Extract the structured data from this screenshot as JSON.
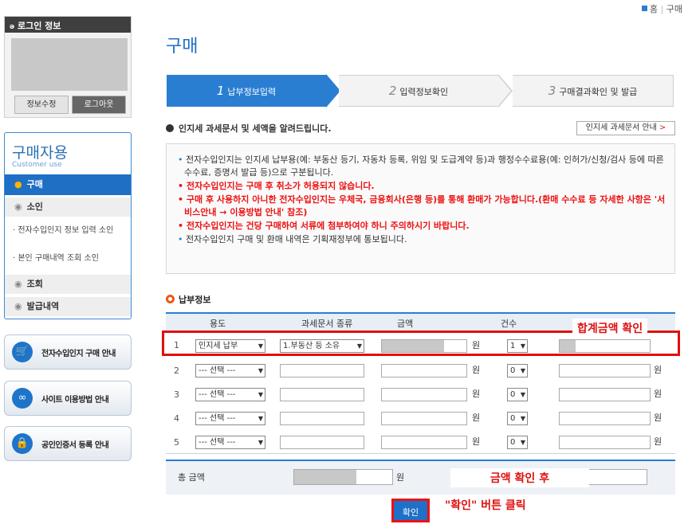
{
  "topnav": {
    "home": "홈",
    "sep": "|",
    "buy": "구매"
  },
  "login": {
    "title": "로그인 정보",
    "edit_btn": "정보수정",
    "logout_btn": "로그아웃"
  },
  "sidemenu": {
    "title": "구매자용",
    "subtitle": "Customer use",
    "items": [
      {
        "label": "구매",
        "active": true
      },
      {
        "label": "소인"
      },
      {
        "sub": "전자수입인지 정보 입력 소인"
      },
      {
        "sub": "본인 구매내역 조회 소인"
      },
      {
        "label": "조회"
      },
      {
        "label": "발급내역"
      }
    ]
  },
  "banners": [
    {
      "label": "전자수입인지 구매 안내",
      "icon": "cart-icon"
    },
    {
      "label": "사이트 이용방법 안내",
      "icon": "glasses-icon"
    },
    {
      "label": "공인인증서 등록 안내",
      "icon": "lock-icon"
    }
  ],
  "page": {
    "title": "구매"
  },
  "steps": [
    {
      "num": "1",
      "label": "납부정보입력"
    },
    {
      "num": "2",
      "label": "입력정보확인"
    },
    {
      "num": "3",
      "label": "구매결과확인 및 발급"
    }
  ],
  "notice": {
    "heading": "인지세 과세문서 및 세액을 알려드립니다.",
    "guide_btn": "인지세 과세문서 안내",
    "lines": [
      "전자수입인지는 인지세 납부용(예: 부동산 등기, 자동차 등록, 위임 및 도급계약 등)과 행정수수료용(예: 인허가/신청/검사 등에 따른 수수료, 증명서 발급 등)으로 구분됩니다.",
      "전자수입인지는 구매 후 취소가 허용되지 않습니다.",
      "구매 후 사용하지 아니한 전자수입인지는 우체국, 금융회사(은행 등)를 통해 환매가 가능합니다.(환매 수수료 등 자세한 사항은 '서비스안내 → 이용방법 안내' 참조)",
      "전자수입인지는 건당 구매하여 서류에 첨부하여야 하니 주의하시기 바랍니다.",
      "전자수입인지 구매 및 환매 내역은 기획재정부에 통보됩니다."
    ]
  },
  "payment": {
    "heading": "납부정보",
    "columns": [
      "용도",
      "과세문서 종류",
      "금액",
      "건수"
    ],
    "rows": [
      {
        "no": "1",
        "usage": "인지세 납부",
        "doc": "1.부동산 등 소유",
        "won": "원",
        "count": "1"
      },
      {
        "no": "2",
        "usage": "--- 선택 ---",
        "doc": "",
        "won": "원",
        "count": "0"
      },
      {
        "no": "3",
        "usage": "--- 선택 ---",
        "doc": "",
        "won": "원",
        "count": "0"
      },
      {
        "no": "4",
        "usage": "--- 선택 ---",
        "doc": "",
        "won": "원",
        "count": "0"
      },
      {
        "no": "5",
        "usage": "--- 선택 ---",
        "doc": "",
        "won": "원",
        "count": "0"
      }
    ]
  },
  "total": {
    "label": "총 금액",
    "won": "원"
  },
  "confirm_btn": "확인",
  "annotations": {
    "check_total": "합계금액 확인",
    "after_check_1": "금액 확인 후",
    "after_check_2": "\"확인\" 버튼 클릭"
  }
}
